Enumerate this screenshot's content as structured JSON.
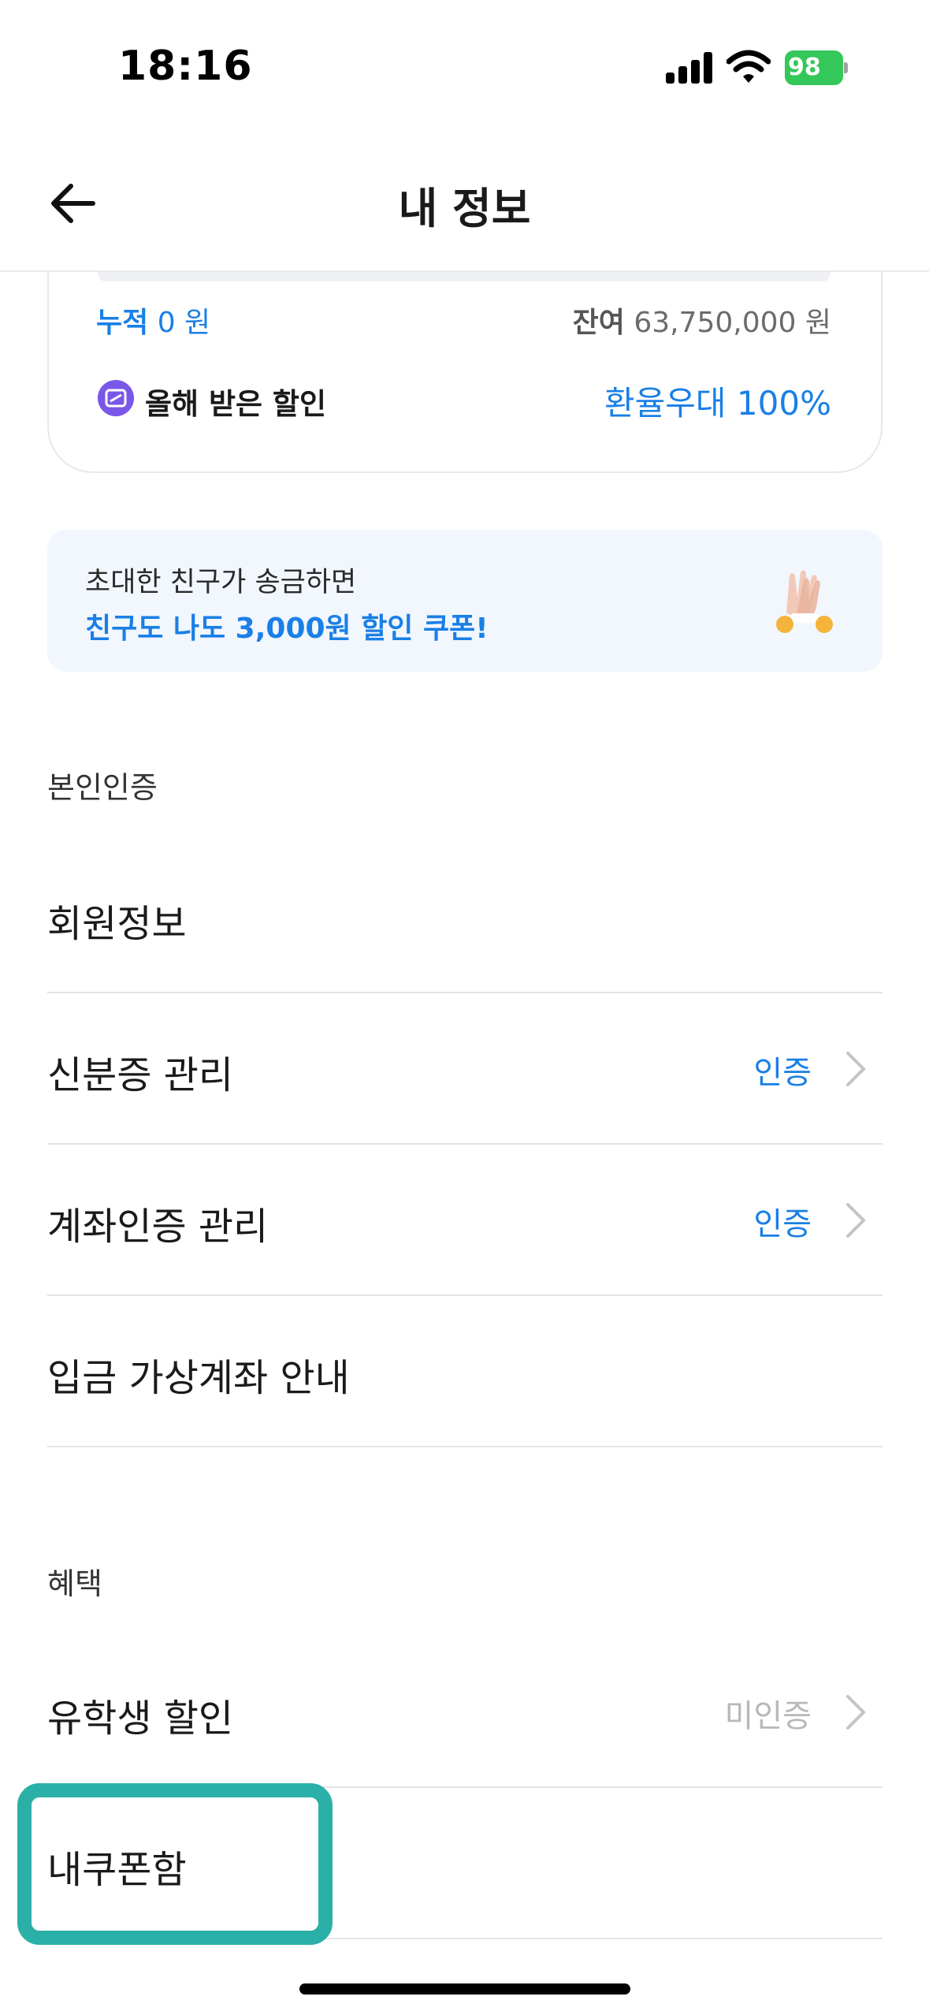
{
  "status_bar": {
    "time": "18:16",
    "battery": "98"
  },
  "header": {
    "title": "내 정보"
  },
  "card": {
    "cumulative_label": "누적",
    "cumulative_value": "0 원",
    "balance_label": "잔여",
    "balance_value": "63,750,000 원",
    "discount_label": "올해 받은 할인",
    "discount_value": "환율우대 100%"
  },
  "banner": {
    "line1": "초대한 친구가 송금하면",
    "line2": "친구도 나도 3,000원 할인 쿠폰!"
  },
  "sections": {
    "verification": {
      "title": "본인인증",
      "rows": [
        {
          "label": "회원정보",
          "status": ""
        },
        {
          "label": "신분증 관리",
          "status": "인증"
        },
        {
          "label": "계좌인증 관리",
          "status": "인증"
        },
        {
          "label": "입금 가상계좌 안내",
          "status": ""
        }
      ]
    },
    "benefits": {
      "title": "혜택",
      "rows": [
        {
          "label": "유학생 할인",
          "status": "미인증"
        },
        {
          "label": "내쿠폰함",
          "status": ""
        }
      ]
    }
  },
  "colors": {
    "accent": "#1a7fe6",
    "highlight": "#2bb0a8",
    "battery": "#34c759"
  }
}
